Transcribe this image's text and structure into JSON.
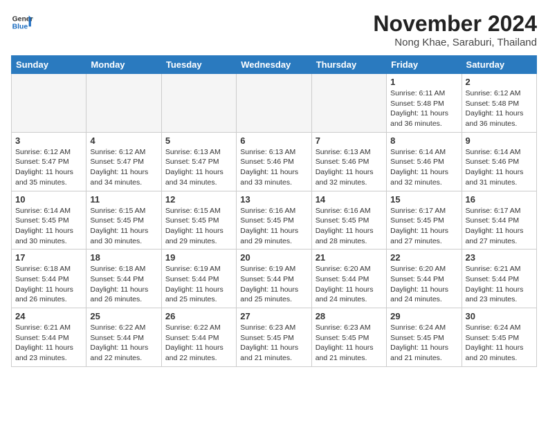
{
  "header": {
    "logo_line1": "General",
    "logo_line2": "Blue",
    "month_title": "November 2024",
    "location": "Nong Khae, Saraburi, Thailand"
  },
  "days_of_week": [
    "Sunday",
    "Monday",
    "Tuesday",
    "Wednesday",
    "Thursday",
    "Friday",
    "Saturday"
  ],
  "weeks": [
    [
      {
        "day": "",
        "empty": true
      },
      {
        "day": "",
        "empty": true
      },
      {
        "day": "",
        "empty": true
      },
      {
        "day": "",
        "empty": true
      },
      {
        "day": "",
        "empty": true
      },
      {
        "day": "1",
        "sunrise": "Sunrise: 6:11 AM",
        "sunset": "Sunset: 5:48 PM",
        "daylight": "Daylight: 11 hours and 36 minutes."
      },
      {
        "day": "2",
        "sunrise": "Sunrise: 6:12 AM",
        "sunset": "Sunset: 5:48 PM",
        "daylight": "Daylight: 11 hours and 36 minutes."
      }
    ],
    [
      {
        "day": "3",
        "sunrise": "Sunrise: 6:12 AM",
        "sunset": "Sunset: 5:47 PM",
        "daylight": "Daylight: 11 hours and 35 minutes."
      },
      {
        "day": "4",
        "sunrise": "Sunrise: 6:12 AM",
        "sunset": "Sunset: 5:47 PM",
        "daylight": "Daylight: 11 hours and 34 minutes."
      },
      {
        "day": "5",
        "sunrise": "Sunrise: 6:13 AM",
        "sunset": "Sunset: 5:47 PM",
        "daylight": "Daylight: 11 hours and 34 minutes."
      },
      {
        "day": "6",
        "sunrise": "Sunrise: 6:13 AM",
        "sunset": "Sunset: 5:46 PM",
        "daylight": "Daylight: 11 hours and 33 minutes."
      },
      {
        "day": "7",
        "sunrise": "Sunrise: 6:13 AM",
        "sunset": "Sunset: 5:46 PM",
        "daylight": "Daylight: 11 hours and 32 minutes."
      },
      {
        "day": "8",
        "sunrise": "Sunrise: 6:14 AM",
        "sunset": "Sunset: 5:46 PM",
        "daylight": "Daylight: 11 hours and 32 minutes."
      },
      {
        "day": "9",
        "sunrise": "Sunrise: 6:14 AM",
        "sunset": "Sunset: 5:46 PM",
        "daylight": "Daylight: 11 hours and 31 minutes."
      }
    ],
    [
      {
        "day": "10",
        "sunrise": "Sunrise: 6:14 AM",
        "sunset": "Sunset: 5:45 PM",
        "daylight": "Daylight: 11 hours and 30 minutes."
      },
      {
        "day": "11",
        "sunrise": "Sunrise: 6:15 AM",
        "sunset": "Sunset: 5:45 PM",
        "daylight": "Daylight: 11 hours and 30 minutes."
      },
      {
        "day": "12",
        "sunrise": "Sunrise: 6:15 AM",
        "sunset": "Sunset: 5:45 PM",
        "daylight": "Daylight: 11 hours and 29 minutes."
      },
      {
        "day": "13",
        "sunrise": "Sunrise: 6:16 AM",
        "sunset": "Sunset: 5:45 PM",
        "daylight": "Daylight: 11 hours and 29 minutes."
      },
      {
        "day": "14",
        "sunrise": "Sunrise: 6:16 AM",
        "sunset": "Sunset: 5:45 PM",
        "daylight": "Daylight: 11 hours and 28 minutes."
      },
      {
        "day": "15",
        "sunrise": "Sunrise: 6:17 AM",
        "sunset": "Sunset: 5:45 PM",
        "daylight": "Daylight: 11 hours and 27 minutes."
      },
      {
        "day": "16",
        "sunrise": "Sunrise: 6:17 AM",
        "sunset": "Sunset: 5:44 PM",
        "daylight": "Daylight: 11 hours and 27 minutes."
      }
    ],
    [
      {
        "day": "17",
        "sunrise": "Sunrise: 6:18 AM",
        "sunset": "Sunset: 5:44 PM",
        "daylight": "Daylight: 11 hours and 26 minutes."
      },
      {
        "day": "18",
        "sunrise": "Sunrise: 6:18 AM",
        "sunset": "Sunset: 5:44 PM",
        "daylight": "Daylight: 11 hours and 26 minutes."
      },
      {
        "day": "19",
        "sunrise": "Sunrise: 6:19 AM",
        "sunset": "Sunset: 5:44 PM",
        "daylight": "Daylight: 11 hours and 25 minutes."
      },
      {
        "day": "20",
        "sunrise": "Sunrise: 6:19 AM",
        "sunset": "Sunset: 5:44 PM",
        "daylight": "Daylight: 11 hours and 25 minutes."
      },
      {
        "day": "21",
        "sunrise": "Sunrise: 6:20 AM",
        "sunset": "Sunset: 5:44 PM",
        "daylight": "Daylight: 11 hours and 24 minutes."
      },
      {
        "day": "22",
        "sunrise": "Sunrise: 6:20 AM",
        "sunset": "Sunset: 5:44 PM",
        "daylight": "Daylight: 11 hours and 24 minutes."
      },
      {
        "day": "23",
        "sunrise": "Sunrise: 6:21 AM",
        "sunset": "Sunset: 5:44 PM",
        "daylight": "Daylight: 11 hours and 23 minutes."
      }
    ],
    [
      {
        "day": "24",
        "sunrise": "Sunrise: 6:21 AM",
        "sunset": "Sunset: 5:44 PM",
        "daylight": "Daylight: 11 hours and 23 minutes."
      },
      {
        "day": "25",
        "sunrise": "Sunrise: 6:22 AM",
        "sunset": "Sunset: 5:44 PM",
        "daylight": "Daylight: 11 hours and 22 minutes."
      },
      {
        "day": "26",
        "sunrise": "Sunrise: 6:22 AM",
        "sunset": "Sunset: 5:44 PM",
        "daylight": "Daylight: 11 hours and 22 minutes."
      },
      {
        "day": "27",
        "sunrise": "Sunrise: 6:23 AM",
        "sunset": "Sunset: 5:45 PM",
        "daylight": "Daylight: 11 hours and 21 minutes."
      },
      {
        "day": "28",
        "sunrise": "Sunrise: 6:23 AM",
        "sunset": "Sunset: 5:45 PM",
        "daylight": "Daylight: 11 hours and 21 minutes."
      },
      {
        "day": "29",
        "sunrise": "Sunrise: 6:24 AM",
        "sunset": "Sunset: 5:45 PM",
        "daylight": "Daylight: 11 hours and 21 minutes."
      },
      {
        "day": "30",
        "sunrise": "Sunrise: 6:24 AM",
        "sunset": "Sunset: 5:45 PM",
        "daylight": "Daylight: 11 hours and 20 minutes."
      }
    ]
  ]
}
